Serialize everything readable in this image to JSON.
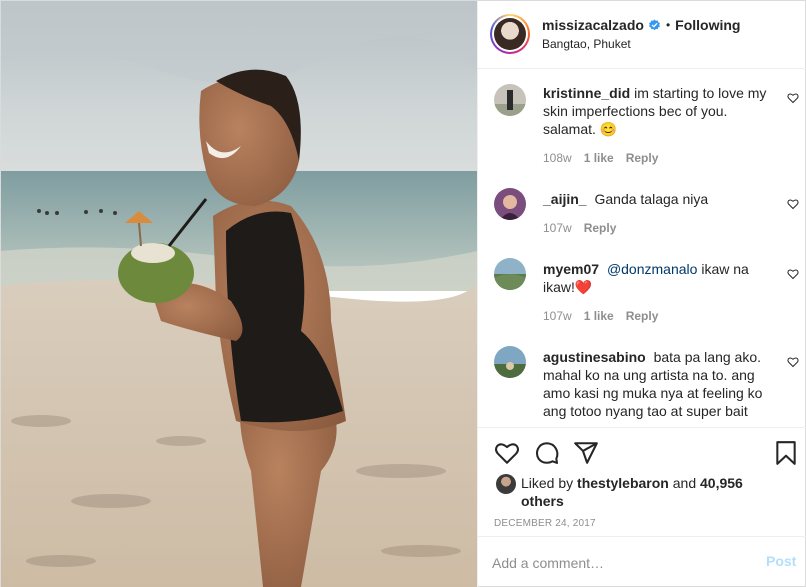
{
  "header": {
    "username": "missizacalzado",
    "verified": true,
    "separator": "•",
    "follow_status": "Following",
    "location": "Bangtao, Phuket"
  },
  "comments": [
    {
      "username": "kristinne_did",
      "text": "im starting to love my skin imperfections bec of you. salamat. 😊",
      "time": "108w",
      "likes": "1 like",
      "reply": "Reply"
    },
    {
      "username": "_aijin_",
      "text": "Ganda talaga niya",
      "time": "107w",
      "reply": "Reply"
    },
    {
      "username": "myem07",
      "mention": "@donzmanalo",
      "text": " ikaw na ikaw!❤️",
      "time": "107w",
      "likes": "1 like",
      "reply": "Reply"
    },
    {
      "username": "agustinesabino",
      "text": "bata pa lang ako. mahal ko na ung artista na to. ang amo kasi ng muka nya at feeling ko ang totoo nyang tao at super bait"
    }
  ],
  "likes": {
    "prefix": "Liked by",
    "user": "thestylebaron",
    "and": "and",
    "others": "40,956 others"
  },
  "date": "DECEMBER 24, 2017",
  "add_comment": {
    "placeholder": "Add a comment…",
    "post_label": "Post"
  },
  "icons": {
    "like": "heart-icon",
    "comment": "comment-bubble-icon",
    "share": "paper-plane-icon",
    "save": "bookmark-icon",
    "verified": "verified-badge-icon"
  },
  "colors": {
    "text": "#262626",
    "secondary": "#8e8e8e",
    "verified": "#3897f0",
    "post_disabled": "#b2dffc",
    "mention": "#00376b"
  }
}
